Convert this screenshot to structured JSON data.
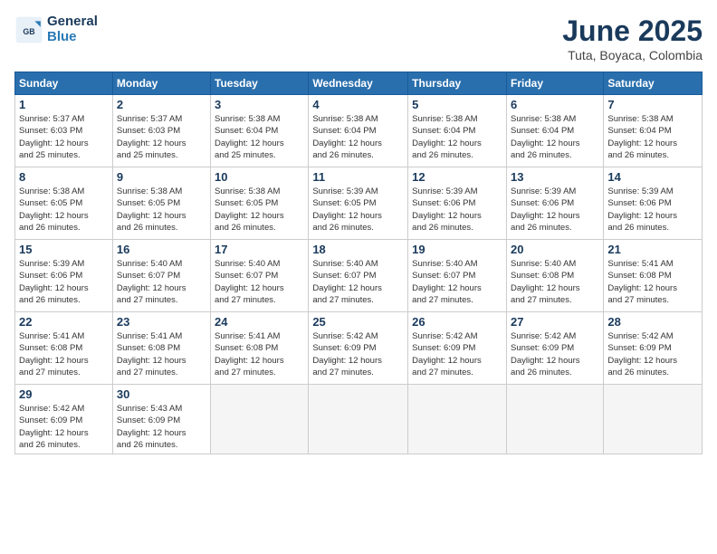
{
  "logo": {
    "general": "General",
    "blue": "Blue"
  },
  "header": {
    "month": "June 2025",
    "location": "Tuta, Boyaca, Colombia"
  },
  "weekdays": [
    "Sunday",
    "Monday",
    "Tuesday",
    "Wednesday",
    "Thursday",
    "Friday",
    "Saturday"
  ],
  "weeks": [
    [
      {
        "day": "1",
        "sunrise": "5:37 AM",
        "sunset": "6:03 PM",
        "daylight": "12 hours and 25 minutes."
      },
      {
        "day": "2",
        "sunrise": "5:37 AM",
        "sunset": "6:03 PM",
        "daylight": "12 hours and 25 minutes."
      },
      {
        "day": "3",
        "sunrise": "5:38 AM",
        "sunset": "6:04 PM",
        "daylight": "12 hours and 25 minutes."
      },
      {
        "day": "4",
        "sunrise": "5:38 AM",
        "sunset": "6:04 PM",
        "daylight": "12 hours and 26 minutes."
      },
      {
        "day": "5",
        "sunrise": "5:38 AM",
        "sunset": "6:04 PM",
        "daylight": "12 hours and 26 minutes."
      },
      {
        "day": "6",
        "sunrise": "5:38 AM",
        "sunset": "6:04 PM",
        "daylight": "12 hours and 26 minutes."
      },
      {
        "day": "7",
        "sunrise": "5:38 AM",
        "sunset": "6:04 PM",
        "daylight": "12 hours and 26 minutes."
      }
    ],
    [
      {
        "day": "8",
        "sunrise": "5:38 AM",
        "sunset": "6:05 PM",
        "daylight": "12 hours and 26 minutes."
      },
      {
        "day": "9",
        "sunrise": "5:38 AM",
        "sunset": "6:05 PM",
        "daylight": "12 hours and 26 minutes."
      },
      {
        "day": "10",
        "sunrise": "5:38 AM",
        "sunset": "6:05 PM",
        "daylight": "12 hours and 26 minutes."
      },
      {
        "day": "11",
        "sunrise": "5:39 AM",
        "sunset": "6:05 PM",
        "daylight": "12 hours and 26 minutes."
      },
      {
        "day": "12",
        "sunrise": "5:39 AM",
        "sunset": "6:06 PM",
        "daylight": "12 hours and 26 minutes."
      },
      {
        "day": "13",
        "sunrise": "5:39 AM",
        "sunset": "6:06 PM",
        "daylight": "12 hours and 26 minutes."
      },
      {
        "day": "14",
        "sunrise": "5:39 AM",
        "sunset": "6:06 PM",
        "daylight": "12 hours and 26 minutes."
      }
    ],
    [
      {
        "day": "15",
        "sunrise": "5:39 AM",
        "sunset": "6:06 PM",
        "daylight": "12 hours and 26 minutes."
      },
      {
        "day": "16",
        "sunrise": "5:40 AM",
        "sunset": "6:07 PM",
        "daylight": "12 hours and 27 minutes."
      },
      {
        "day": "17",
        "sunrise": "5:40 AM",
        "sunset": "6:07 PM",
        "daylight": "12 hours and 27 minutes."
      },
      {
        "day": "18",
        "sunrise": "5:40 AM",
        "sunset": "6:07 PM",
        "daylight": "12 hours and 27 minutes."
      },
      {
        "day": "19",
        "sunrise": "5:40 AM",
        "sunset": "6:07 PM",
        "daylight": "12 hours and 27 minutes."
      },
      {
        "day": "20",
        "sunrise": "5:40 AM",
        "sunset": "6:08 PM",
        "daylight": "12 hours and 27 minutes."
      },
      {
        "day": "21",
        "sunrise": "5:41 AM",
        "sunset": "6:08 PM",
        "daylight": "12 hours and 27 minutes."
      }
    ],
    [
      {
        "day": "22",
        "sunrise": "5:41 AM",
        "sunset": "6:08 PM",
        "daylight": "12 hours and 27 minutes."
      },
      {
        "day": "23",
        "sunrise": "5:41 AM",
        "sunset": "6:08 PM",
        "daylight": "12 hours and 27 minutes."
      },
      {
        "day": "24",
        "sunrise": "5:41 AM",
        "sunset": "6:08 PM",
        "daylight": "12 hours and 27 minutes."
      },
      {
        "day": "25",
        "sunrise": "5:42 AM",
        "sunset": "6:09 PM",
        "daylight": "12 hours and 27 minutes."
      },
      {
        "day": "26",
        "sunrise": "5:42 AM",
        "sunset": "6:09 PM",
        "daylight": "12 hours and 27 minutes."
      },
      {
        "day": "27",
        "sunrise": "5:42 AM",
        "sunset": "6:09 PM",
        "daylight": "12 hours and 26 minutes."
      },
      {
        "day": "28",
        "sunrise": "5:42 AM",
        "sunset": "6:09 PM",
        "daylight": "12 hours and 26 minutes."
      }
    ],
    [
      {
        "day": "29",
        "sunrise": "5:42 AM",
        "sunset": "6:09 PM",
        "daylight": "12 hours and 26 minutes."
      },
      {
        "day": "30",
        "sunrise": "5:43 AM",
        "sunset": "6:09 PM",
        "daylight": "12 hours and 26 minutes."
      },
      null,
      null,
      null,
      null,
      null
    ]
  ],
  "labels": {
    "sunrise": "Sunrise:",
    "sunset": "Sunset:",
    "daylight": "Daylight:"
  }
}
